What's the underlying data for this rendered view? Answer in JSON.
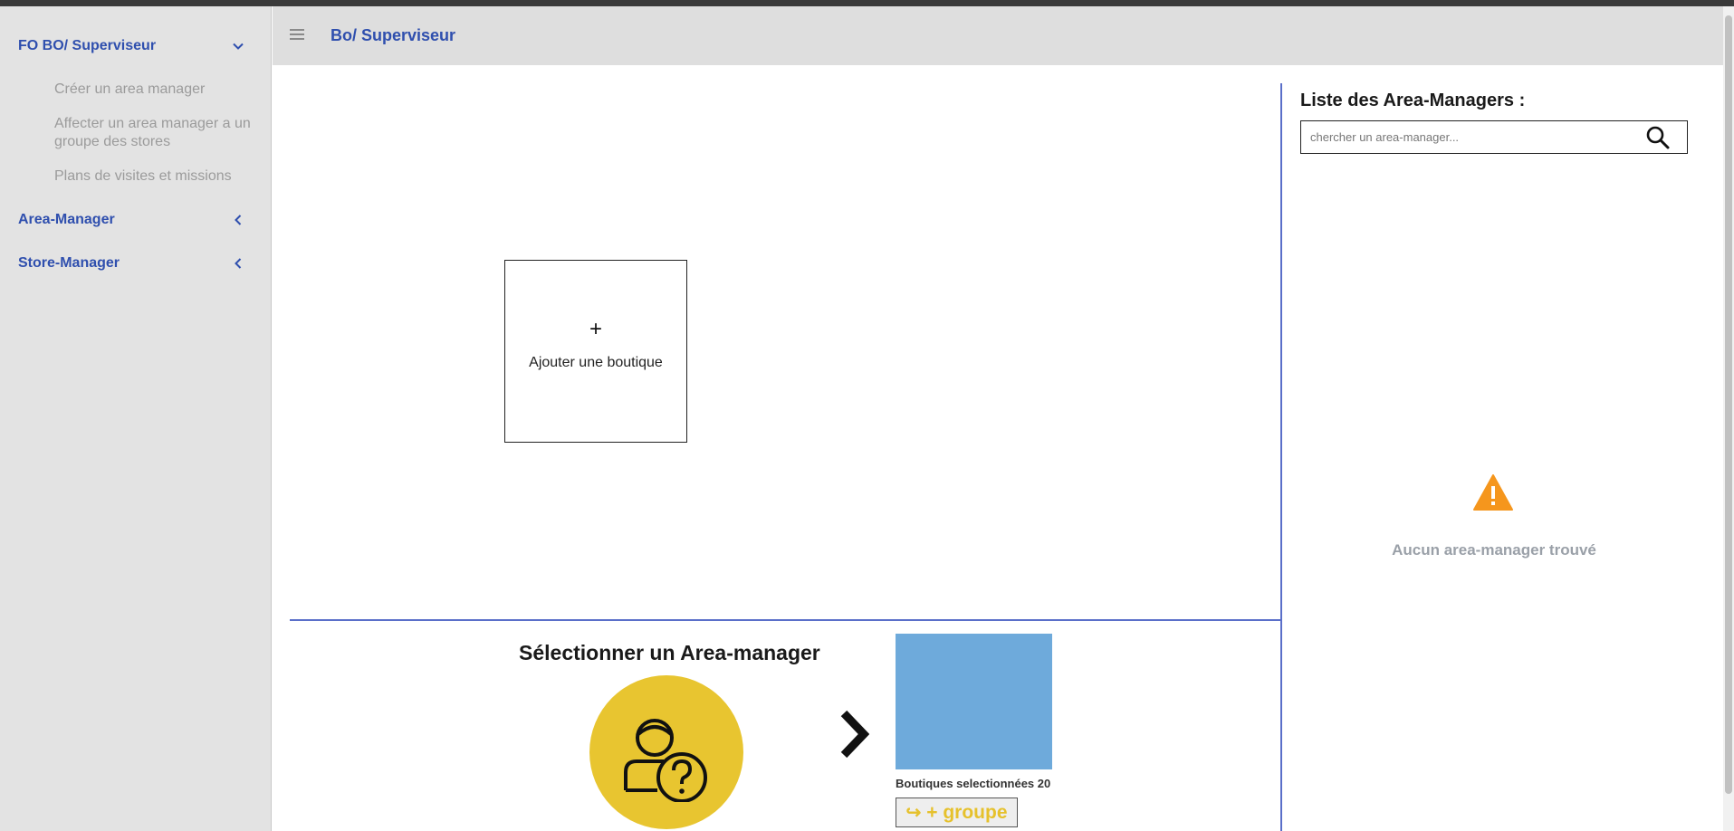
{
  "sidebar": {
    "sections": [
      {
        "label": "FO BO/ Superviseur",
        "expanded": true,
        "icon": "chevron-down-icon"
      },
      {
        "label": "Area-Manager",
        "expanded": false,
        "icon": "chevron-left-icon"
      },
      {
        "label": "Store-Manager",
        "expanded": false,
        "icon": "chevron-left-icon"
      }
    ],
    "sub_items": [
      "Créer un area manager",
      "Affecter un area manager a un groupe des stores",
      "Plans de visites et missions"
    ]
  },
  "header": {
    "title": "Bo/ Superviseur",
    "menu_icon": "hamburger-icon"
  },
  "main": {
    "add_card": {
      "plus": "+",
      "label": "Ajouter une boutique"
    },
    "select_title": "Sélectionner un Area-manager",
    "stores_selected_label": "Boutiques selectionnées 20",
    "group_button": {
      "arrow": "↪",
      "label": "+ groupe"
    }
  },
  "right_panel": {
    "title": "Liste des Area-Managers :",
    "search_placeholder": "chercher un area-manager...",
    "empty_message": "Aucun area-manager trouvé"
  },
  "colors": {
    "accent_blue": "#2f4fae",
    "divider_blue": "#5a6fc9",
    "avatar_yellow": "#e8c530",
    "store_blue": "#6eaadb",
    "warning_orange": "#f5961d",
    "muted_gray": "#9b9b9b"
  }
}
